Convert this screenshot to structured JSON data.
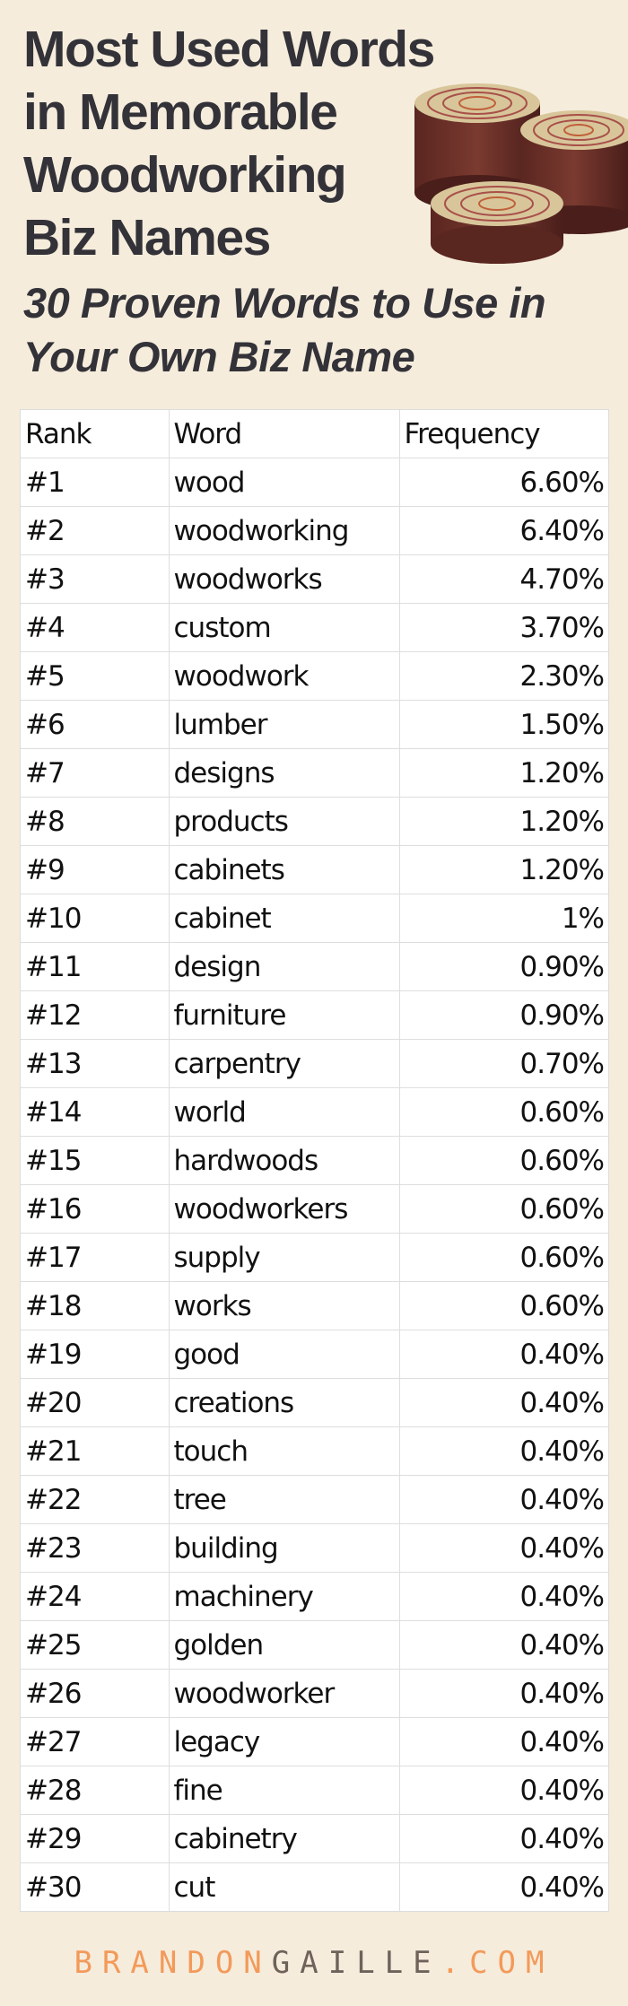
{
  "header": {
    "title_lines": [
      "Most Used Words",
      "in Memorable",
      "Woodworking",
      "Biz Names"
    ],
    "subtitle_lines": [
      "30 Proven Words to Use in",
      "Your Own Biz Name"
    ],
    "illustration": "wood-logs-icon"
  },
  "chart_data": {
    "type": "table",
    "title": "Most Used Words in Memorable Woodworking Biz Names",
    "subtitle": "30 Proven Words to Use in Your Own Biz Name",
    "columns": [
      "Rank",
      "Word",
      "Frequency"
    ],
    "rows": [
      [
        "#1",
        "wood",
        "6.60%"
      ],
      [
        "#2",
        "woodworking",
        "6.40%"
      ],
      [
        "#3",
        "woodworks",
        "4.70%"
      ],
      [
        "#4",
        "custom",
        "3.70%"
      ],
      [
        "#5",
        "woodwork",
        "2.30%"
      ],
      [
        "#6",
        "lumber",
        "1.50%"
      ],
      [
        "#7",
        "designs",
        "1.20%"
      ],
      [
        "#8",
        "products",
        "1.20%"
      ],
      [
        "#9",
        "cabinets",
        "1.20%"
      ],
      [
        "#10",
        "cabinet",
        "1%"
      ],
      [
        "#11",
        "design",
        "0.90%"
      ],
      [
        "#12",
        "furniture",
        "0.90%"
      ],
      [
        "#13",
        "carpentry",
        "0.70%"
      ],
      [
        "#14",
        "world",
        "0.60%"
      ],
      [
        "#15",
        "hardwoods",
        "0.60%"
      ],
      [
        "#16",
        "woodworkers",
        "0.60%"
      ],
      [
        "#17",
        "supply",
        "0.60%"
      ],
      [
        "#18",
        "works",
        "0.60%"
      ],
      [
        "#19",
        "good",
        "0.40%"
      ],
      [
        "#20",
        "creations",
        "0.40%"
      ],
      [
        "#21",
        "touch",
        "0.40%"
      ],
      [
        "#22",
        "tree",
        "0.40%"
      ],
      [
        "#23",
        "building",
        "0.40%"
      ],
      [
        "#24",
        "machinery",
        "0.40%"
      ],
      [
        "#25",
        "golden",
        "0.40%"
      ],
      [
        "#26",
        "woodworker",
        "0.40%"
      ],
      [
        "#27",
        "legacy",
        "0.40%"
      ],
      [
        "#28",
        "fine",
        "0.40%"
      ],
      [
        "#29",
        "cabinetry",
        "0.40%"
      ],
      [
        "#30",
        "cut",
        "0.40%"
      ]
    ]
  },
  "footer": {
    "brand_part1": "BRANDON",
    "brand_part2": "GAILLE",
    "brand_part3": ".COM"
  },
  "colors": {
    "background": "#f5ecdc",
    "title_text": "#333238",
    "brand_orange": "#f39a5a",
    "brand_gray": "#6e625a"
  }
}
